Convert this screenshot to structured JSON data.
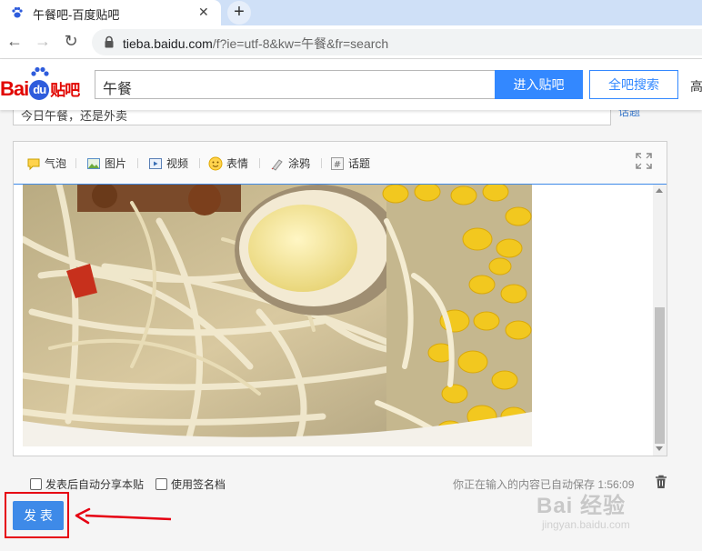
{
  "browser": {
    "tab_title": "午餐吧-百度贴吧",
    "tab_close": "✕",
    "new_tab": "+",
    "nav": {
      "back": "←",
      "forward": "→",
      "reload": "↻"
    },
    "url": {
      "domain": "tieba.baidu.com",
      "path": "/f?ie=utf-8&kw=午餐&fr=search"
    }
  },
  "header": {
    "logo": {
      "bai": "Bai",
      "du": "du",
      "tieba": "贴吧"
    },
    "search_value": "午餐",
    "enter_button": "进入贴吧",
    "all_search_button": "全吧搜索",
    "edge_text": "高"
  },
  "editor": {
    "title_value": "今日午餐，还是外卖",
    "topic_link": "话题",
    "tools": [
      {
        "icon": "bubble-icon",
        "label": "气泡"
      },
      {
        "icon": "picture-icon",
        "label": "图片"
      },
      {
        "icon": "video-icon",
        "label": "视频"
      },
      {
        "icon": "emoji-icon",
        "label": "表情"
      },
      {
        "icon": "graffiti-icon",
        "label": "涂鸦"
      },
      {
        "icon": "topic-icon",
        "label": "话题"
      }
    ]
  },
  "options": {
    "share_label": "发表后自动分享本贴",
    "signature_label": "使用签名档",
    "autosave": "你正在输入的内容已自动保存 1:56:09"
  },
  "post_button": "发 表",
  "watermark": {
    "main": "Bai 经验",
    "sub": "jingyan.baidu.com"
  },
  "colors": {
    "accent": "#3388ff",
    "highlight": "#e60012"
  }
}
